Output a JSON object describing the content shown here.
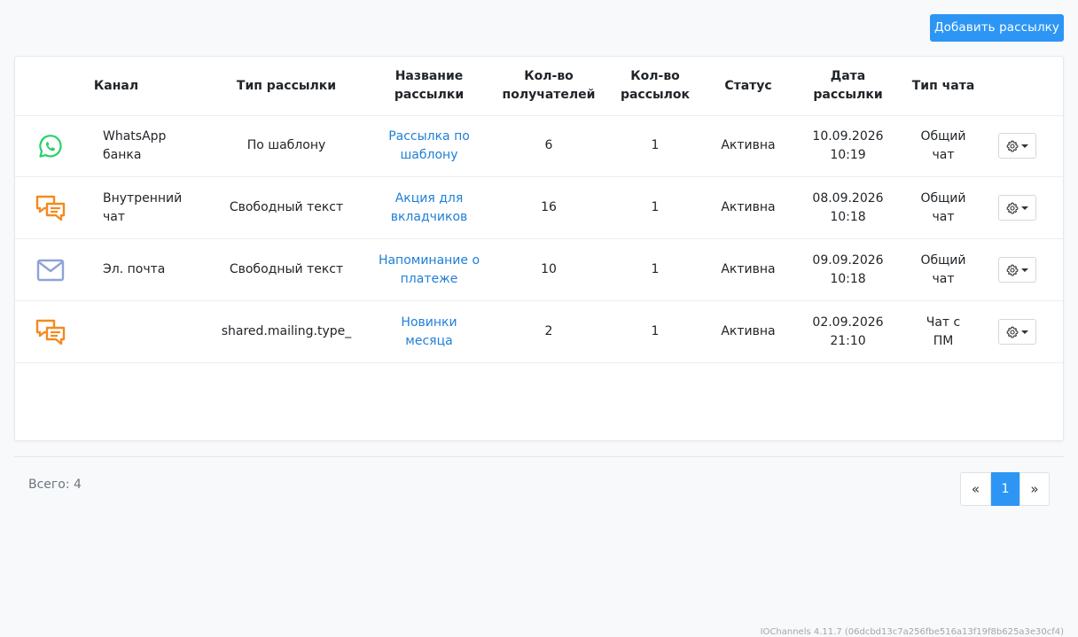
{
  "toolbar": {
    "add_label": "Добавить рассылку"
  },
  "table": {
    "headers": {
      "channel": "Канал",
      "type": "Тип рассылки",
      "name": [
        "Название",
        "рассылки"
      ],
      "recipients": [
        "Кол-во",
        "получателей"
      ],
      "count": [
        "Кол-во",
        "рассылок"
      ],
      "status": "Статус",
      "date": [
        "Дата",
        "рассылки"
      ],
      "chat_type": "Тип чата"
    },
    "rows": [
      {
        "icon": "whatsapp-icon",
        "channel": [
          "WhatsApp",
          "банка"
        ],
        "type": "По шаблону",
        "name": [
          "Рассылка по",
          "шаблону"
        ],
        "recipients": "6",
        "count": "1",
        "status": "Активна",
        "date": [
          "10.09.2026",
          "10:19"
        ],
        "chat_type": [
          "Общий",
          "чат"
        ]
      },
      {
        "icon": "chat-icon",
        "channel": [
          "Внутренний",
          "чат"
        ],
        "type": "Свободный текст",
        "name": [
          "Акция для",
          "вкладчиков"
        ],
        "recipients": "16",
        "count": "1",
        "status": "Активна",
        "date": [
          "08.09.2026",
          "10:18"
        ],
        "chat_type": [
          "Общий",
          "чат"
        ]
      },
      {
        "icon": "mail-icon",
        "channel": [
          "Эл. почта",
          ""
        ],
        "type": "Свободный текст",
        "name": [
          "Напоминание о",
          "платеже"
        ],
        "recipients": "10",
        "count": "1",
        "status": "Активна",
        "date": [
          "09.09.2026",
          "10:18"
        ],
        "chat_type": [
          "Общий",
          "чат"
        ]
      },
      {
        "icon": "chat-icon",
        "channel": [
          "",
          ""
        ],
        "type": "shared.mailing.type_",
        "name": [
          "Новинки",
          "месяца"
        ],
        "recipients": "2",
        "count": "1",
        "status": "Активна",
        "date": [
          "02.09.2026",
          "21:10"
        ],
        "chat_type": [
          "Чат с",
          "ПМ"
        ]
      }
    ]
  },
  "pagination": {
    "total_label": "Всего: 4",
    "prev": "«",
    "current": "1",
    "next": "»"
  },
  "footer": {
    "version": "IOChannels 4.11.7 (06dcbd13c7a256fbe516a13f19f8b625a3e30cf4)"
  },
  "colors": {
    "accent": "#2d96f5",
    "link": "#1f7fd8",
    "whatsapp": "#25d366",
    "chat": "#f5891f",
    "mail": "#8fa3d8"
  }
}
